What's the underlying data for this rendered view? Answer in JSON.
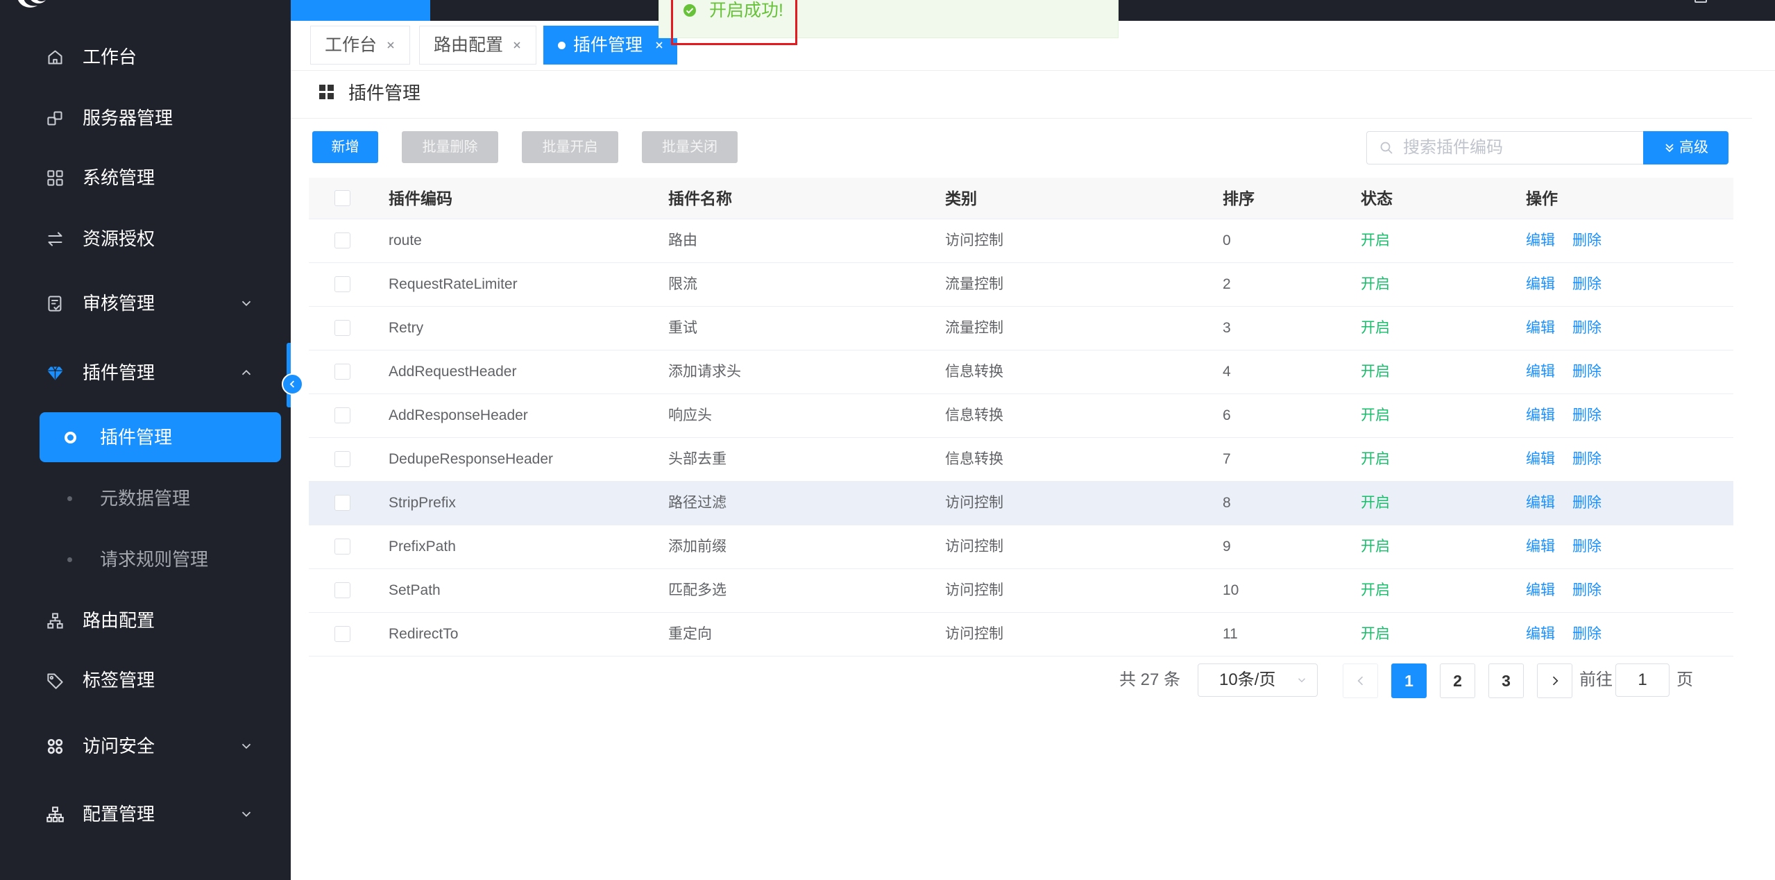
{
  "colors": {
    "accent": "#1890ff",
    "sidebar_bg": "#1f222b",
    "status_enabled": "#19be6b",
    "toast_bg": "#f0f9eb",
    "toast_text": "#67c23a",
    "highlight_border": "#e5191e"
  },
  "toast": {
    "message": "开启成功!",
    "icon": "success-check-icon"
  },
  "sidebar": {
    "items": [
      {
        "label": "工作台",
        "icon": "home-icon"
      },
      {
        "label": "服务器管理",
        "icon": "server-icon"
      },
      {
        "label": "系统管理",
        "icon": "grid-icon"
      },
      {
        "label": "资源授权",
        "icon": "swap-icon"
      },
      {
        "label": "审核管理",
        "icon": "audit-icon",
        "expanded": false
      },
      {
        "label": "插件管理",
        "icon": "diamond-icon",
        "expanded": true,
        "children": [
          {
            "label": "插件管理",
            "active": true
          },
          {
            "label": "元数据管理",
            "active": false
          },
          {
            "label": "请求规则管理",
            "active": false
          }
        ]
      },
      {
        "label": "路由配置",
        "icon": "sitemap-icon"
      },
      {
        "label": "标签管理",
        "icon": "tag-icon"
      },
      {
        "label": "访问安全",
        "icon": "apps-icon",
        "expanded": false
      },
      {
        "label": "配置管理",
        "icon": "hierarchy-icon",
        "expanded": false
      }
    ]
  },
  "tabs": [
    {
      "label": "工作台",
      "active": false
    },
    {
      "label": "路由配置",
      "active": false
    },
    {
      "label": "插件管理",
      "active": true
    }
  ],
  "page": {
    "title": "插件管理",
    "icon": "grid-icon"
  },
  "toolbar": {
    "add": "新增",
    "batch_delete": "批量删除",
    "batch_enable": "批量开启",
    "batch_disable": "批量关闭",
    "search_placeholder": "搜索插件编码",
    "advanced": "高级"
  },
  "table": {
    "columns": [
      "插件编码",
      "插件名称",
      "类别",
      "排序",
      "状态",
      "操作"
    ],
    "actions": {
      "edit": "编辑",
      "delete": "删除"
    },
    "rows": [
      {
        "code": "route",
        "name": "路由",
        "category": "访问控制",
        "sort": "0",
        "status": "开启"
      },
      {
        "code": "RequestRateLimiter",
        "name": "限流",
        "category": "流量控制",
        "sort": "2",
        "status": "开启"
      },
      {
        "code": "Retry",
        "name": "重试",
        "category": "流量控制",
        "sort": "3",
        "status": "开启"
      },
      {
        "code": "AddRequestHeader",
        "name": "添加请求头",
        "category": "信息转换",
        "sort": "4",
        "status": "开启"
      },
      {
        "code": "AddResponseHeader",
        "name": "响应头",
        "category": "信息转换",
        "sort": "6",
        "status": "开启"
      },
      {
        "code": "DedupeResponseHeader",
        "name": "头部去重",
        "category": "信息转换",
        "sort": "7",
        "status": "开启"
      },
      {
        "code": "StripPrefix",
        "name": "路径过滤",
        "category": "访问控制",
        "sort": "8",
        "status": "开启",
        "hovered": true
      },
      {
        "code": "PrefixPath",
        "name": "添加前缀",
        "category": "访问控制",
        "sort": "9",
        "status": "开启"
      },
      {
        "code": "SetPath",
        "name": "匹配多选",
        "category": "访问控制",
        "sort": "10",
        "status": "开启"
      },
      {
        "code": "RedirectTo",
        "name": "重定向",
        "category": "访问控制",
        "sort": "11",
        "status": "开启"
      }
    ]
  },
  "pagination": {
    "total_label": "共 27 条",
    "page_size": "10条/页",
    "pages": [
      "1",
      "2",
      "3"
    ],
    "current": "1",
    "goto_label": "前往",
    "goto_value": "1",
    "page_suffix": "页"
  }
}
